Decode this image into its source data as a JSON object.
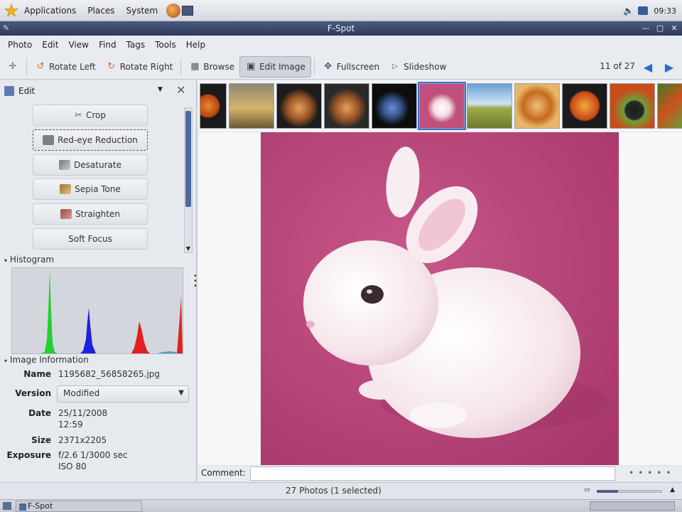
{
  "top_panel": {
    "menus": [
      "Applications",
      "Places",
      "System"
    ],
    "clock": "09:33"
  },
  "window": {
    "title": "F-Spot"
  },
  "menubar": [
    "Photo",
    "Edit",
    "View",
    "Find",
    "Tags",
    "Tools",
    "Help"
  ],
  "toolbar": {
    "rotate_left": "Rotate Left",
    "rotate_right": "Rotate Right",
    "browse": "Browse",
    "edit_image": "Edit Image",
    "fullscreen": "Fullscreen",
    "slideshow": "Slideshow",
    "counter": "11 of 27"
  },
  "sidebar": {
    "edit_label": "Edit",
    "tools": [
      "Crop",
      "Red-eye Reduction",
      "Desaturate",
      "Sepia Tone",
      "Straighten",
      "Soft Focus"
    ],
    "histogram_title": "Histogram",
    "info_title": "Image Information",
    "info": {
      "name_label": "Name",
      "name_value": "1195682_56858265.jpg",
      "version_label": "Version",
      "version_value": "Modified",
      "date_label": "Date",
      "date_value": "25/11/2008",
      "time_value": "12:59",
      "size_label": "Size",
      "size_value": "2371x2205",
      "exposure_label": "Exposure",
      "exposure_value": "f/2.6 1/3000 sec",
      "iso_value": "ISO 80"
    }
  },
  "comment_label": "Comment:",
  "status": {
    "text": "27 Photos (1 selected)"
  },
  "taskbar": {
    "task": "F-Spot"
  },
  "colors": {
    "photo_bg": "#bd4b7a",
    "accent": "#2a6bc8",
    "titlebar": "#3b4868"
  }
}
